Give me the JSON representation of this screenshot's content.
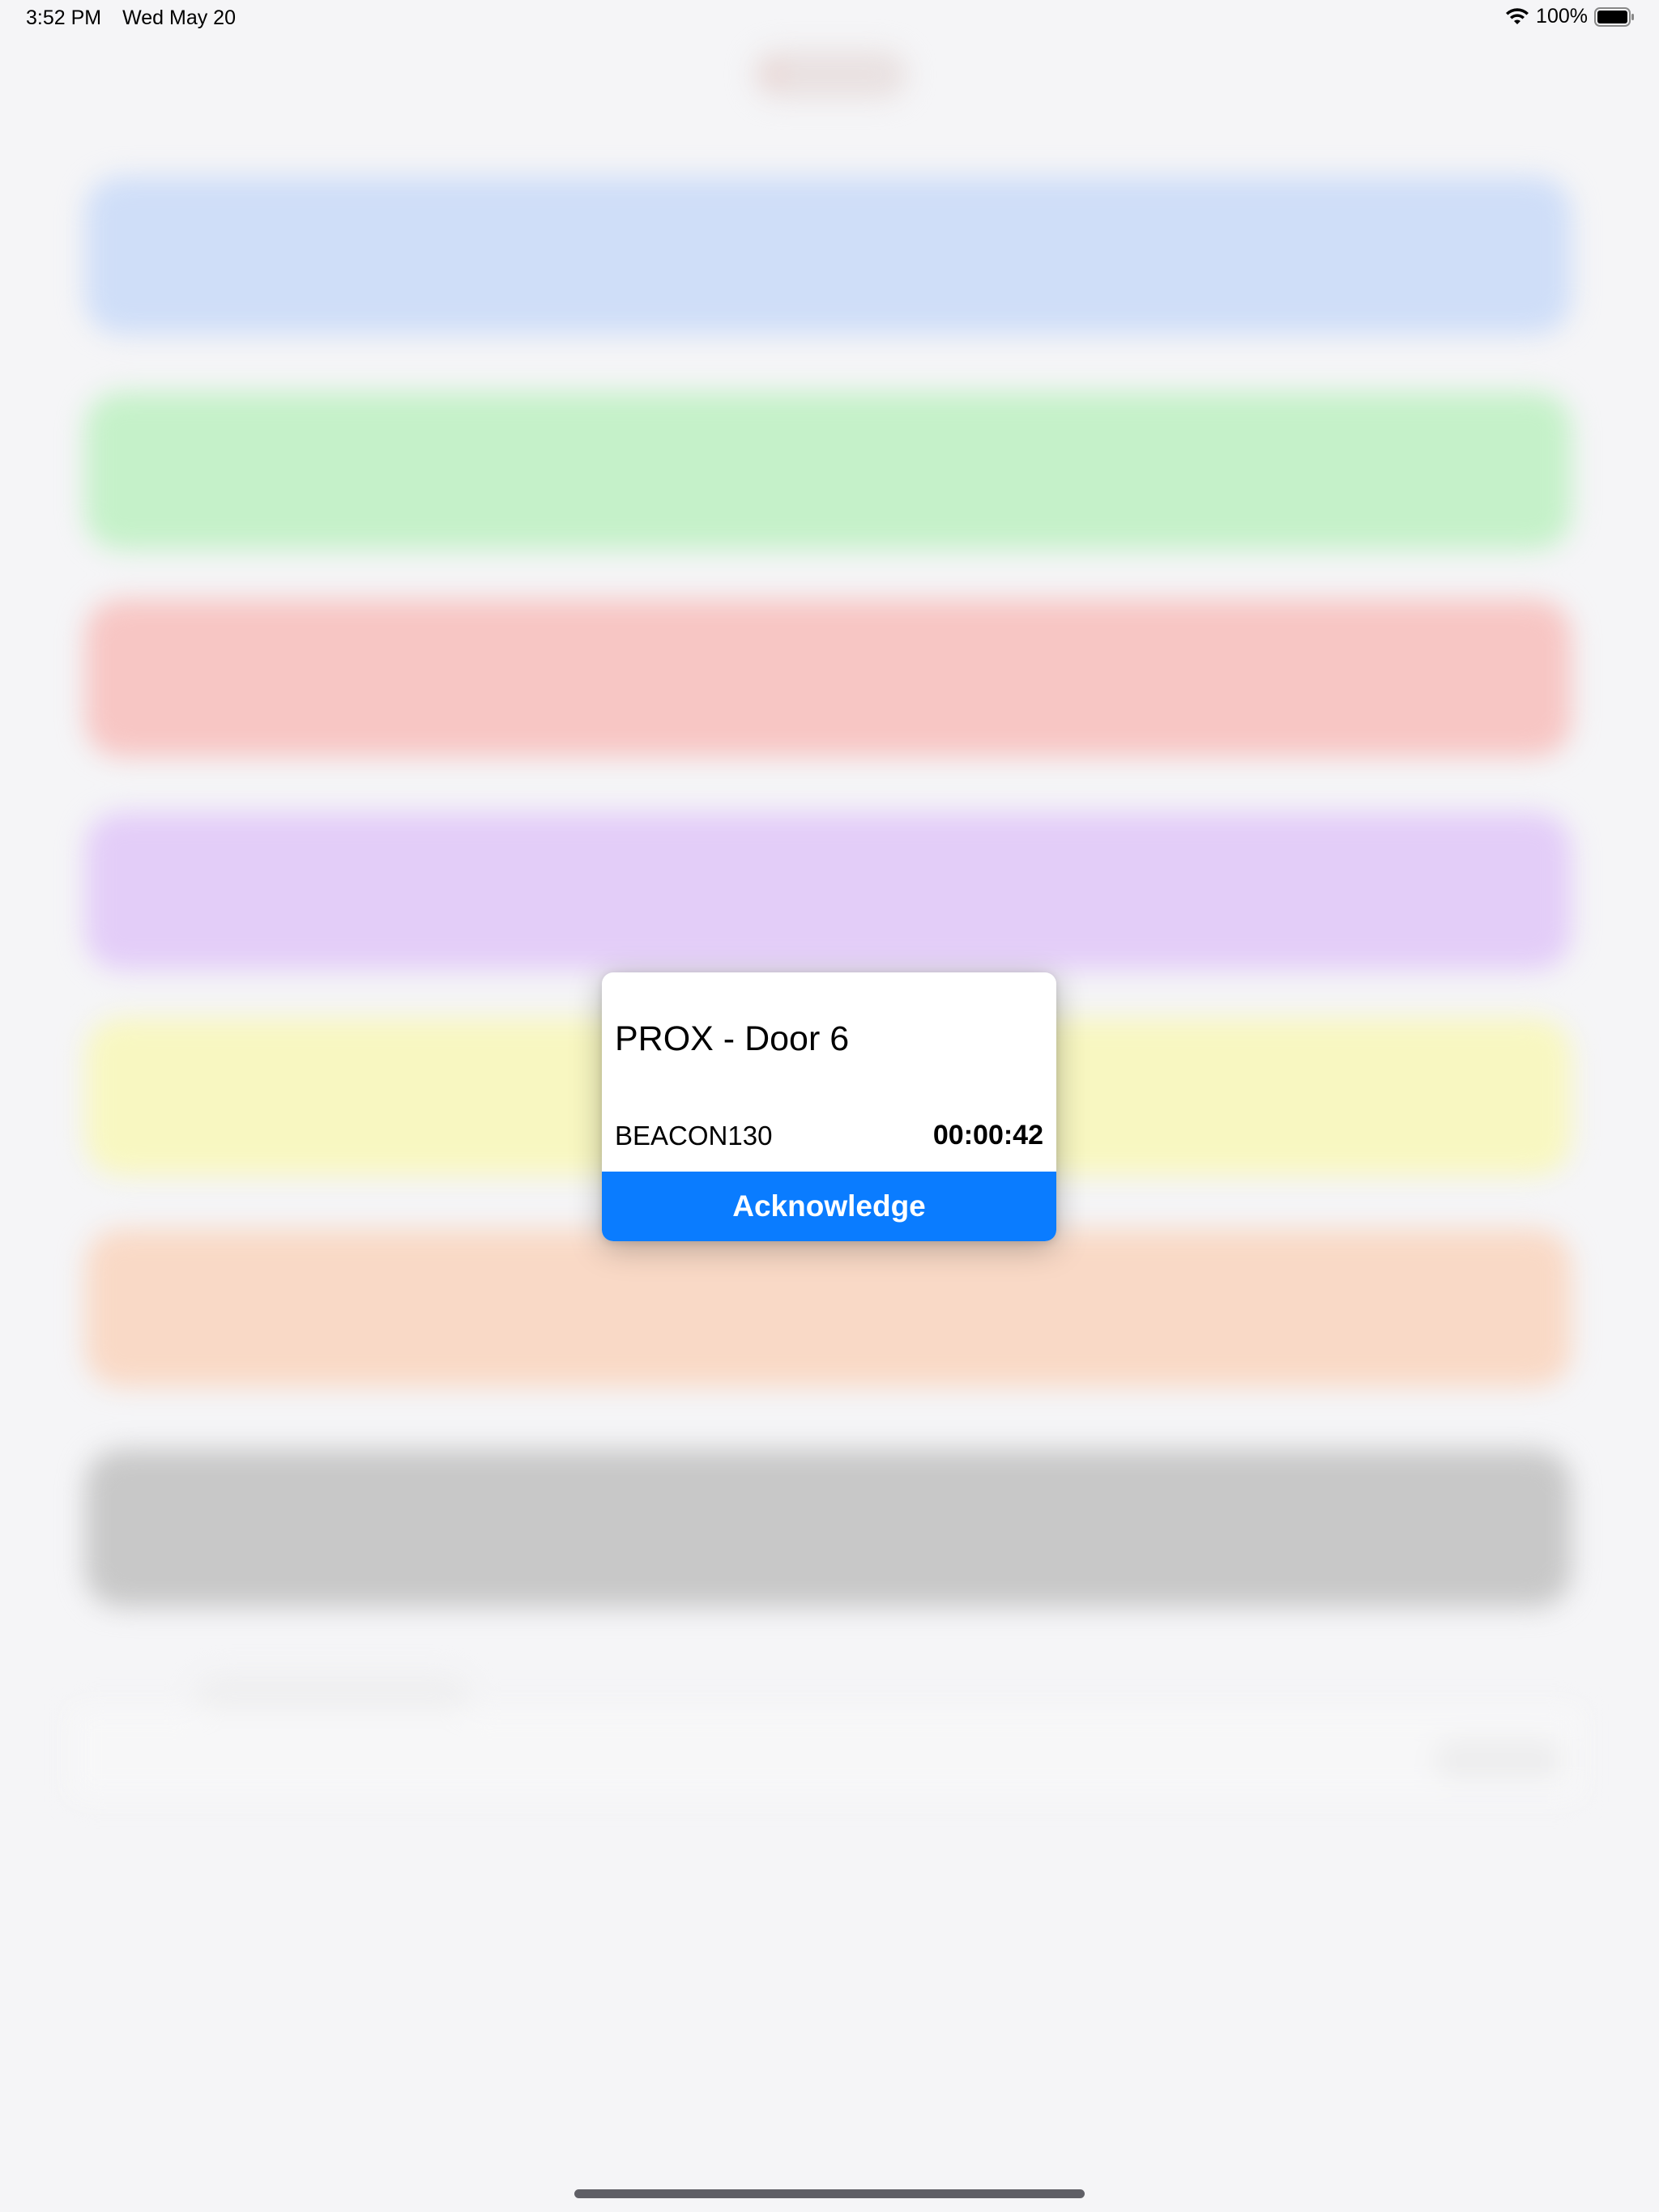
{
  "status_bar": {
    "time": "3:52 PM",
    "date": "Wed May 20",
    "battery_percent": "100%",
    "wifi_icon": "wifi-icon",
    "battery_icon": "battery-icon"
  },
  "alert": {
    "title": "PROX - Door 6",
    "beacon": "BEACON130",
    "timer": "00:00:42",
    "acknowledge_label": "Acknowledge",
    "accent_color": "#0a7cff"
  },
  "background_colors": [
    "#cfdef8",
    "#c5f1c9",
    "#f7c6c4",
    "#e3cdf8",
    "#f8f7c1",
    "#f9d9c6",
    "#c8c8c8"
  ]
}
